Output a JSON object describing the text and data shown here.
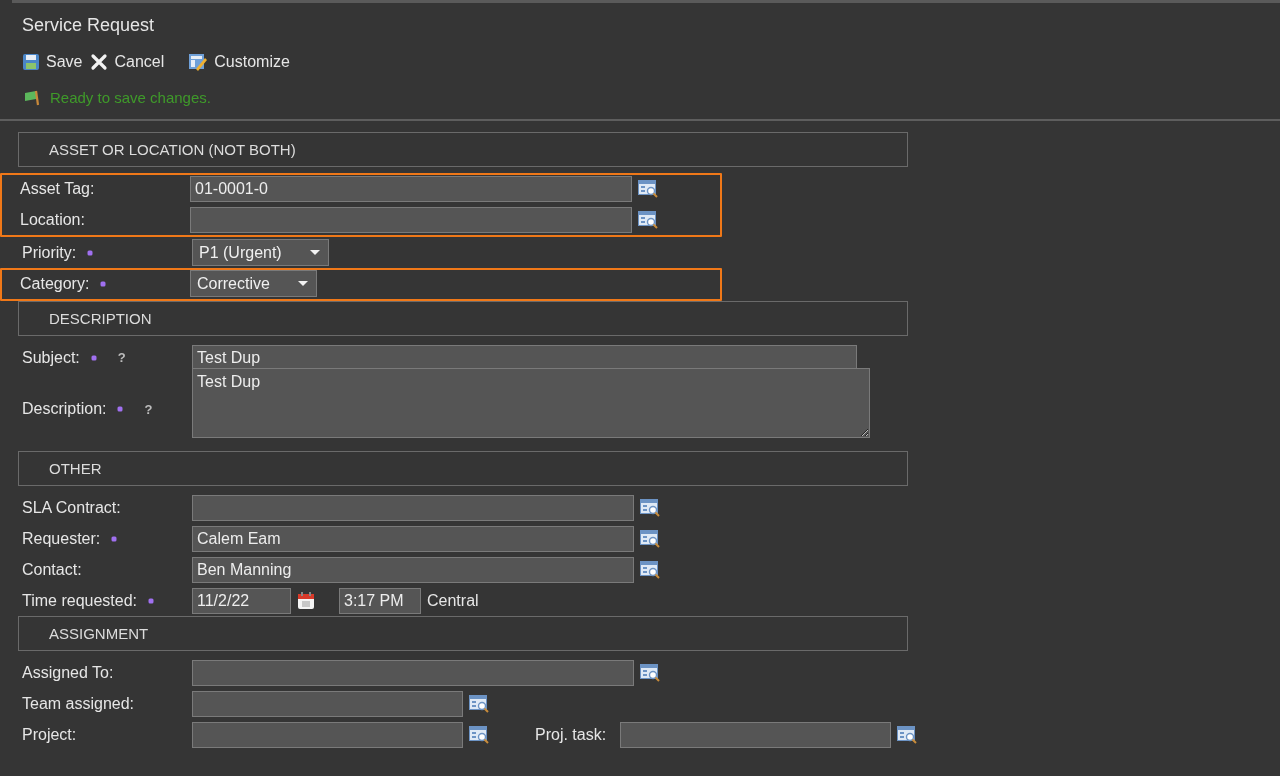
{
  "title": "Service Request",
  "toolbar": [
    {
      "kind": "save",
      "label": "Save"
    },
    {
      "kind": "cancel",
      "label": "Cancel"
    },
    {
      "kind": "customize",
      "label": "Customize"
    }
  ],
  "status": {
    "text": "Ready to save changes."
  },
  "sections": [
    {
      "title": "ASSET OR LOCATION (NOT BOTH)",
      "rows": [
        {
          "kind": "highlight",
          "rows": [
            {
              "kind": "lookup",
              "label": "Asset Tag:",
              "required": false,
              "value": "01-0001-0"
            },
            {
              "kind": "lookup",
              "label": "Location:",
              "required": false,
              "value": ""
            }
          ]
        },
        {
          "kind": "select",
          "label": "Priority:",
          "required": true,
          "value": "P1 (Urgent)"
        },
        {
          "kind": "highlight",
          "rows": [
            {
              "kind": "select",
              "label": "Category:",
              "required": true,
              "value": "Corrective"
            }
          ]
        }
      ]
    },
    {
      "title": "DESCRIPTION",
      "rows": [
        {
          "kind": "text",
          "label": "Subject:",
          "required": true,
          "help": "?",
          "value": "Test Dup"
        },
        {
          "kind": "textarea",
          "label": "Description:",
          "required": true,
          "help": "?",
          "value": "Test Dup"
        }
      ]
    },
    {
      "title": "OTHER",
      "rows": [
        {
          "kind": "lookup",
          "label": "SLA Contract:",
          "required": false,
          "value": ""
        },
        {
          "kind": "lookup",
          "label": "Requester:",
          "required": true,
          "value": "Calem Eam"
        },
        {
          "kind": "lookup",
          "label": "Contact:",
          "required": false,
          "value": "Ben Manning"
        },
        {
          "kind": "datetime",
          "label": "Time requested:",
          "required": true,
          "date": "11/2/22",
          "time": "3:17 PM",
          "zone": "Central"
        }
      ]
    },
    {
      "title": "ASSIGNMENT",
      "rows": [
        {
          "kind": "lookup",
          "label": "Assigned To:",
          "required": false,
          "value": ""
        },
        {
          "kind": "lookup-short",
          "label": "Team assigned:",
          "required": false,
          "value": ""
        },
        {
          "kind": "lookup-short",
          "label": "Project:",
          "required": false,
          "value": "",
          "extra": {
            "label": "Proj. task:"
          }
        }
      ]
    }
  ]
}
